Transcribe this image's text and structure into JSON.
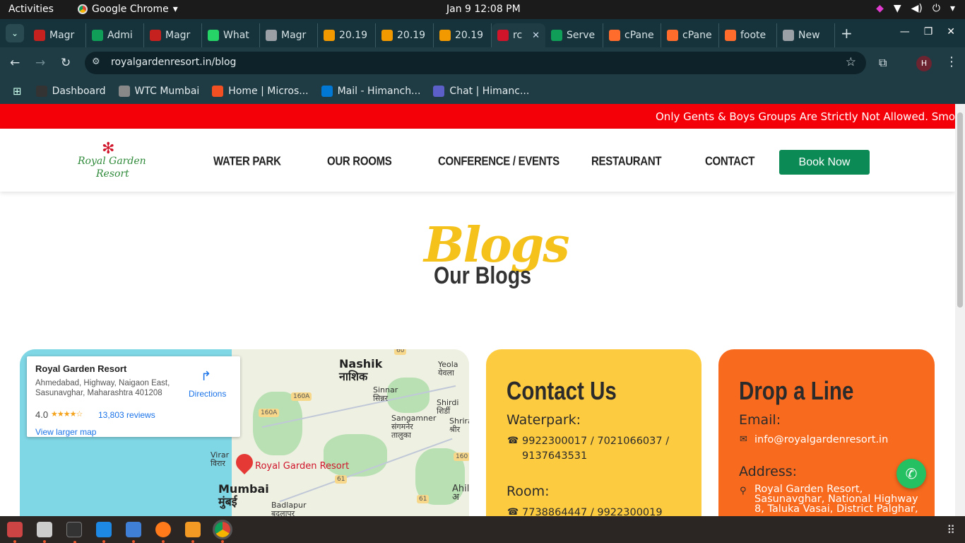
{
  "system": {
    "activities": "Activities",
    "app_name": "Google Chrome",
    "clock": "Jan 9  12:08 PM"
  },
  "tabs": [
    {
      "label": "Magr",
      "color": "#c5221f"
    },
    {
      "label": "Admi",
      "color": "#0f9d58"
    },
    {
      "label": "Magr",
      "color": "#c5221f"
    },
    {
      "label": "What",
      "color": "#25d366"
    },
    {
      "label": "Magr",
      "color": "#9aa0a6"
    },
    {
      "label": "20.19",
      "color": "#f29900"
    },
    {
      "label": "20.19",
      "color": "#f29900"
    },
    {
      "label": "20.19",
      "color": "#f29900"
    },
    {
      "label": "rc",
      "color": "#d0142a",
      "active": true
    },
    {
      "label": "Serve",
      "color": "#0f9d58"
    },
    {
      "label": "cPane",
      "color": "#ff6c2c"
    },
    {
      "label": "cPane",
      "color": "#ff6c2c"
    },
    {
      "label": "foote",
      "color": "#ff6c2c"
    },
    {
      "label": "New",
      "color": "#9aa0a6"
    }
  ],
  "omnibox": {
    "url": "royalgardenresort.in/blog"
  },
  "bookmarks": [
    {
      "label": "Dashboard",
      "color": "#333"
    },
    {
      "label": "WTC Mumbai",
      "color": "#888"
    },
    {
      "label": "Home | Micros...",
      "color": "#f25022"
    },
    {
      "label": "Mail - Himanch...",
      "color": "#0078d4"
    },
    {
      "label": "Chat | Himanc...",
      "color": "#5b5fc7"
    }
  ],
  "site": {
    "ticker": "Only Gents & Boys Groups Are Strictly Not Allowed. Smoking &",
    "logo": {
      "line1": "Royal Garden",
      "line2": "Resort"
    },
    "nav": [
      "WATER PARK",
      "OUR ROOMS",
      "CONFERENCE / EVENTS",
      "RESTAURANT",
      "CONTACT"
    ],
    "book_now": "Book Now",
    "script_title": "Blogs",
    "title": "Our Blogs"
  },
  "map": {
    "place_name": "Royal Garden Resort",
    "address": "Ahmedabad, Highway, Naigaon East, Sasunavghar, Maharashtra 401208",
    "rating": "4.0",
    "stars": "★★★★☆",
    "reviews": "13,803 reviews",
    "directions": "Directions",
    "view_larger": "View larger map",
    "pin_label": "Royal Garden Resort",
    "cities": {
      "nashik": "Nashik",
      "nashik_local": "नाशिक",
      "sinnar": "Sinnar",
      "sinnar_local": "सिन्नर",
      "yeola": "Yeola",
      "yeola_local": "येवला",
      "shirdi": "Shirdi",
      "shirdi_local": "शिर्डी",
      "shrira": "Shrira",
      "shrira_local": "श्रीर",
      "sangamner": "Sangamner",
      "sangamner_local": "संगमनेर",
      "taluka": "तालुका",
      "virar": "Virar",
      "virar_local": "विरार",
      "mumbai": "Mumbai",
      "mumbai_local": "मुंबई",
      "badlapur": "Badlapur",
      "badlapur_local": "बदलापूर",
      "ahil": "Ahil",
      "ahil_local": "अ"
    },
    "shields": [
      "160A",
      "160A",
      "160",
      "61",
      "61",
      "60"
    ]
  },
  "contact": {
    "title": "Contact Us",
    "waterpark_label": "Waterpark:",
    "waterpark_phones": "9922300017 / 7021066037 /",
    "waterpark_phones2": "9137643531",
    "room_label": "Room:",
    "room_phones": "7738864447 / 9922300019"
  },
  "drop": {
    "title": "Drop a Line",
    "email_label": "Email:",
    "email": "info@royalgardenresort.in",
    "address_label": "Address:",
    "address1": "Royal Garden Resort,",
    "address2": "Sasunavghar, National Highway",
    "address3": "8, Taluka Vasai, District Palghar,"
  }
}
